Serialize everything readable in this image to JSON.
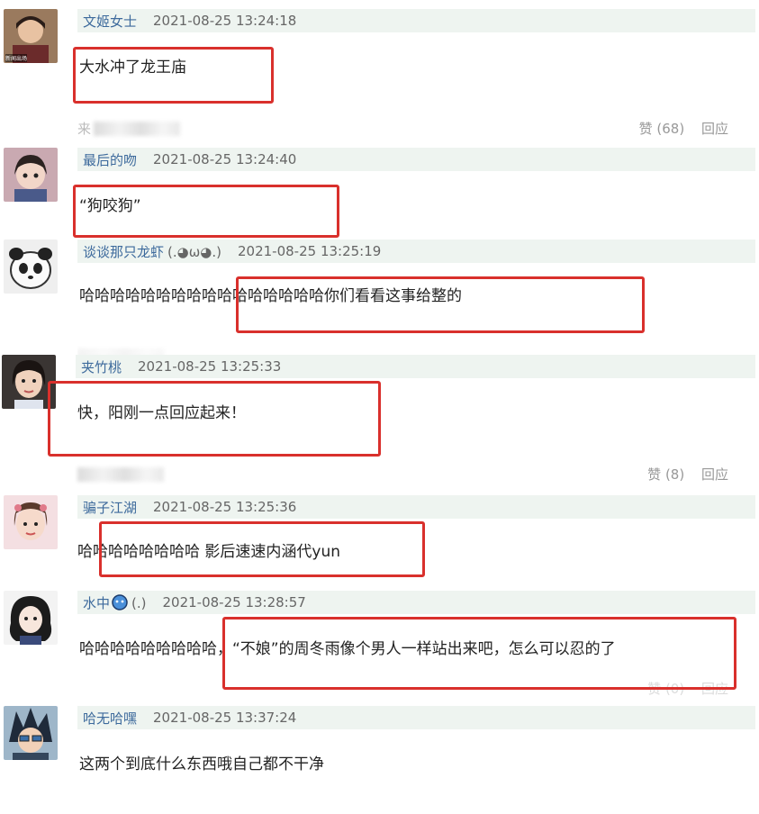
{
  "comments": [
    {
      "user": "文姬女士",
      "time": "2021-08-25 13:24:18",
      "text": "大水冲了龙王庙",
      "source": "来",
      "like": "赞 (68)",
      "reply": "回应",
      "avatar_label": "新闻出场"
    },
    {
      "user": "最后的吻",
      "time": "2021-08-25 13:24:40",
      "text": "“狗咬狗”"
    },
    {
      "user": "谈谈那只龙虾",
      "user_extra": "(.◕ω◕.)",
      "time": "2021-08-25 13:25:19",
      "text": "哈哈哈哈哈哈哈哈哈哈哈哈哈哈哈哈你们看看这事给整的"
    },
    {
      "user": "夹竹桃",
      "time": "2021-08-25 13:25:33",
      "text": "快，阳刚一点回应起来！",
      "like": "赞 (8)",
      "reply": "回应"
    },
    {
      "user": "骗子江湖",
      "time": "2021-08-25 13:25:36",
      "text": "哈哈哈哈哈哈哈哈 影后速速内涵代yun"
    },
    {
      "user": "水中",
      "user_extra": "(.)",
      "time": "2021-08-25 13:28:57",
      "text": "哈哈哈哈哈哈哈哈哈，“不娘”的周冬雨像个男人一样站出来吧，怎么可以忍的了",
      "like": "赞 (0)",
      "reply": "回应"
    },
    {
      "user": "哈无哈嘿",
      "time": "2021-08-25 13:37:24",
      "text": "这两个到底什么东西哦自己都不干净"
    }
  ],
  "colors": {
    "highlight": "#d9302c",
    "username": "#3d6a9c",
    "meta_bg": "#eef4f0"
  }
}
